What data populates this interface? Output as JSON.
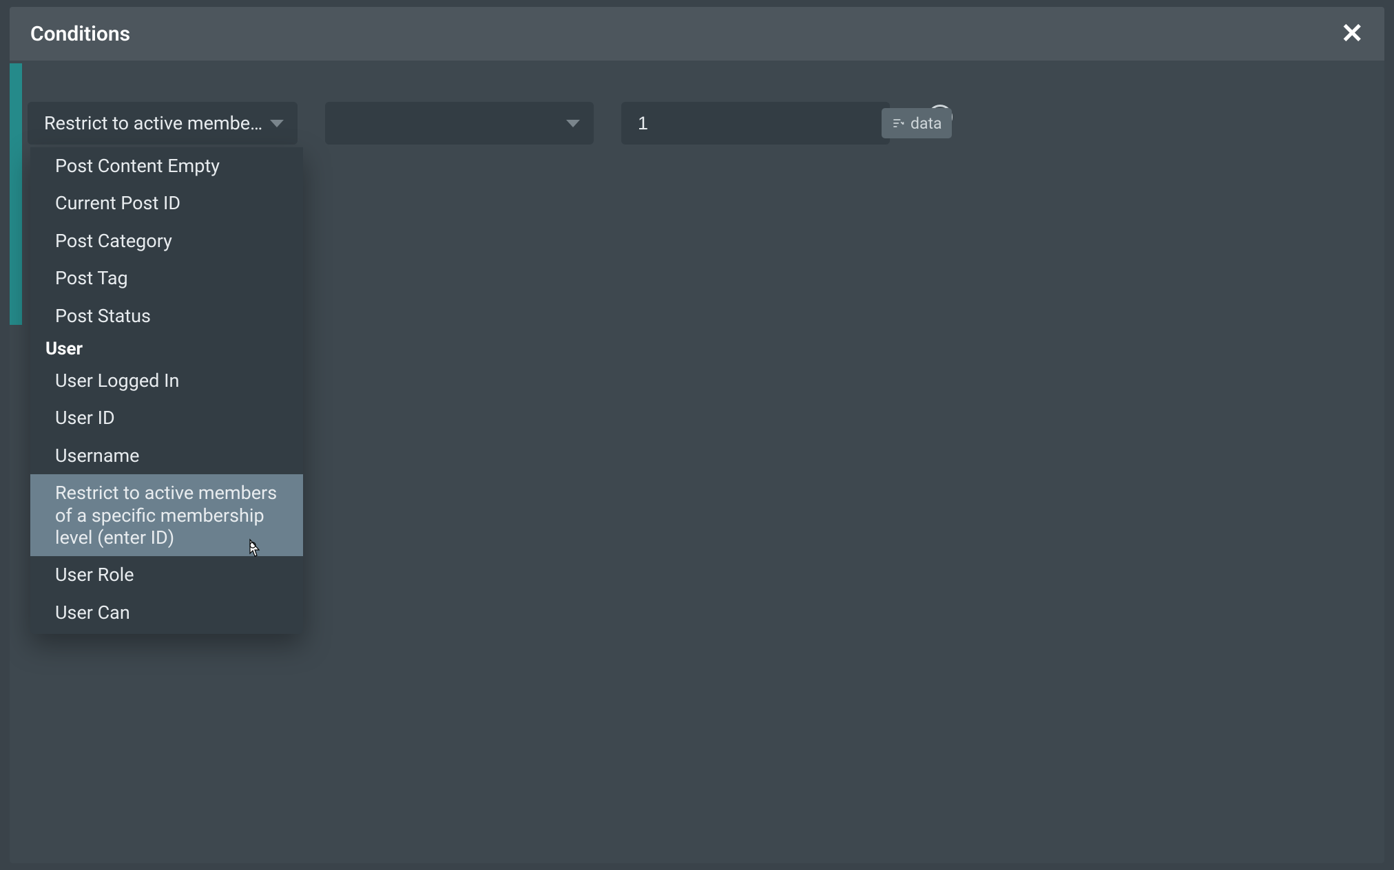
{
  "header": {
    "title": "Conditions"
  },
  "row": {
    "select1_label": "Restrict to active members",
    "input_value": "1",
    "data_chip_label": "data"
  },
  "dropdown": {
    "items_top": [
      "Post Content Empty",
      "Current Post ID",
      "Post Category",
      "Post Tag",
      "Post Status"
    ],
    "group_label": "User",
    "items_user": [
      "User Logged In",
      "User ID",
      "Username",
      "Restrict to active members of a specific membership level (enter ID)",
      "User Role",
      "User Can"
    ],
    "highlighted_index": 3
  }
}
